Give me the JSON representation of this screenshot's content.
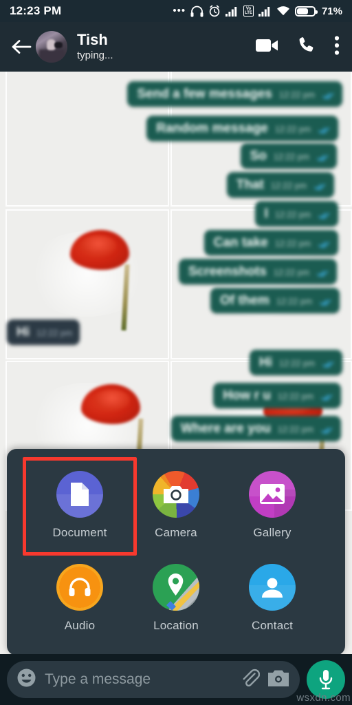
{
  "status_bar": {
    "time": "12:23 PM",
    "battery_percent": "71%",
    "volte_label": "VoLTE",
    "icons": [
      "more-dots-icon",
      "headphones-icon",
      "alarm-icon",
      "signal-icon",
      "volte-icon",
      "signal-icon",
      "wifi-icon",
      "battery-icon"
    ]
  },
  "app_bar": {
    "contact_name": "Tish",
    "presence": "typing...",
    "icons": [
      "back-arrow-icon",
      "video-call-icon",
      "voice-call-icon",
      "overflow-menu-icon"
    ]
  },
  "chat": {
    "messages": [
      {
        "text": "Send a few messages",
        "time": "12:22 pm",
        "direction": "out",
        "status": "read"
      },
      {
        "text": "Random message",
        "time": "12:22 pm",
        "direction": "out",
        "status": "read"
      },
      {
        "text": "So",
        "time": "12:22 pm",
        "direction": "out",
        "status": "read"
      },
      {
        "text": "That",
        "time": "12:22 pm",
        "direction": "out",
        "status": "read"
      },
      {
        "text": "I",
        "time": "12:22 pm",
        "direction": "out",
        "status": "read"
      },
      {
        "text": "Can take",
        "time": "12:22 pm",
        "direction": "out",
        "status": "read"
      },
      {
        "text": "Screenshots",
        "time": "12:22 pm",
        "direction": "out",
        "status": "read"
      },
      {
        "text": "Of them",
        "time": "12:22 pm",
        "direction": "out",
        "status": "read"
      },
      {
        "text": "Hi",
        "time": "12:22 pm",
        "direction": "in",
        "status": "none"
      },
      {
        "text": "Hi",
        "time": "12:22 pm",
        "direction": "out",
        "status": "read"
      },
      {
        "text": "How r u",
        "time": "12:22 pm",
        "direction": "out",
        "status": "read"
      },
      {
        "text": "Where are you",
        "time": "12:22 pm",
        "direction": "out",
        "status": "read"
      }
    ]
  },
  "attachment_panel": {
    "items": [
      {
        "label": "Document",
        "icon": "document-icon",
        "color": "#5b63d3",
        "highlighted": true
      },
      {
        "label": "Camera",
        "icon": "camera-icon",
        "color": "#ef5a2b",
        "highlighted": false
      },
      {
        "label": "Gallery",
        "icon": "gallery-icon",
        "color": "#c13ec4",
        "highlighted": false
      },
      {
        "label": "Audio",
        "icon": "audio-icon",
        "color": "#f79210",
        "highlighted": false
      },
      {
        "label": "Location",
        "icon": "location-icon",
        "color": "#2ba154",
        "highlighted": false
      },
      {
        "label": "Contact",
        "icon": "contact-icon",
        "color": "#2aa8e8",
        "highlighted": false
      }
    ],
    "highlight_color": "#f8392e"
  },
  "input_bar": {
    "placeholder": "Type a message",
    "value": "",
    "icons": [
      "emoji-icon",
      "attach-paperclip-icon",
      "camera-icon",
      "microphone-icon"
    ],
    "mic_color": "#0ea47f"
  },
  "watermark": {
    "text": "wsxdn.com"
  }
}
